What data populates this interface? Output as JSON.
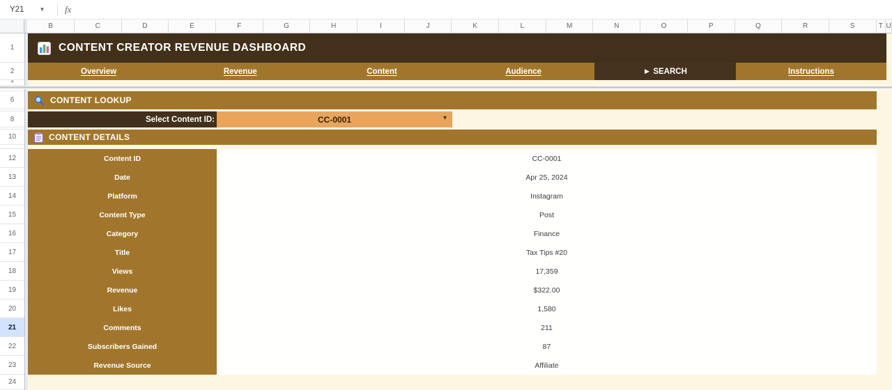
{
  "chrome": {
    "name_box": "Y21",
    "formula_icon": "fx",
    "selected_row": "21",
    "column_headers": [
      "B",
      "C",
      "D",
      "E",
      "F",
      "G",
      "H",
      "I",
      "J",
      "K",
      "L",
      "M",
      "N",
      "O",
      "P",
      "Q",
      "R",
      "S",
      "T",
      "U"
    ],
    "row_numbers": [
      "1",
      "2",
      "4",
      "6",
      "8",
      "10",
      "12",
      "13",
      "14",
      "15",
      "16",
      "17",
      "18",
      "19",
      "20",
      "21",
      "22",
      "23",
      "24"
    ]
  },
  "title": {
    "text": "CONTENT CREATOR REVENUE DASHBOARD"
  },
  "nav": {
    "tabs": [
      {
        "label": "Overview",
        "active": false
      },
      {
        "label": "Revenue",
        "active": false
      },
      {
        "label": "Content",
        "active": false
      },
      {
        "label": "Audience",
        "active": false
      },
      {
        "label": "SEARCH",
        "active": true,
        "prefix": "►"
      },
      {
        "label": "Instructions",
        "active": false
      }
    ]
  },
  "lookup": {
    "header": "CONTENT LOOKUP",
    "select_label": "Select Content ID:",
    "selected_value": "CC-0001",
    "dropdown_caret": "▾"
  },
  "details": {
    "header": "CONTENT DETAILS",
    "fields": [
      {
        "label": "Content ID",
        "value": "CC-0001"
      },
      {
        "label": "Date",
        "value": "Apr 25, 2024"
      },
      {
        "label": "Platform",
        "value": "Instagram"
      },
      {
        "label": "Content Type",
        "value": "Post"
      },
      {
        "label": "Category",
        "value": "Finance"
      },
      {
        "label": "Title",
        "value": "Tax Tips #20"
      },
      {
        "label": "Views",
        "value": "17,359"
      },
      {
        "label": "Revenue",
        "value": "$322.00"
      },
      {
        "label": "Likes",
        "value": "1,580"
      },
      {
        "label": "Comments",
        "value": "211"
      },
      {
        "label": "Subscribers Gained",
        "value": "87"
      },
      {
        "label": "Revenue Source",
        "value": "Affiliate"
      }
    ]
  },
  "colors": {
    "dark_brown": "#42301a",
    "gold": "#a1762c",
    "dropdown_orange": "#e9a55c",
    "sheet_cream": "#fdf6e3",
    "selected_row_blue": "#d3e3fd"
  }
}
